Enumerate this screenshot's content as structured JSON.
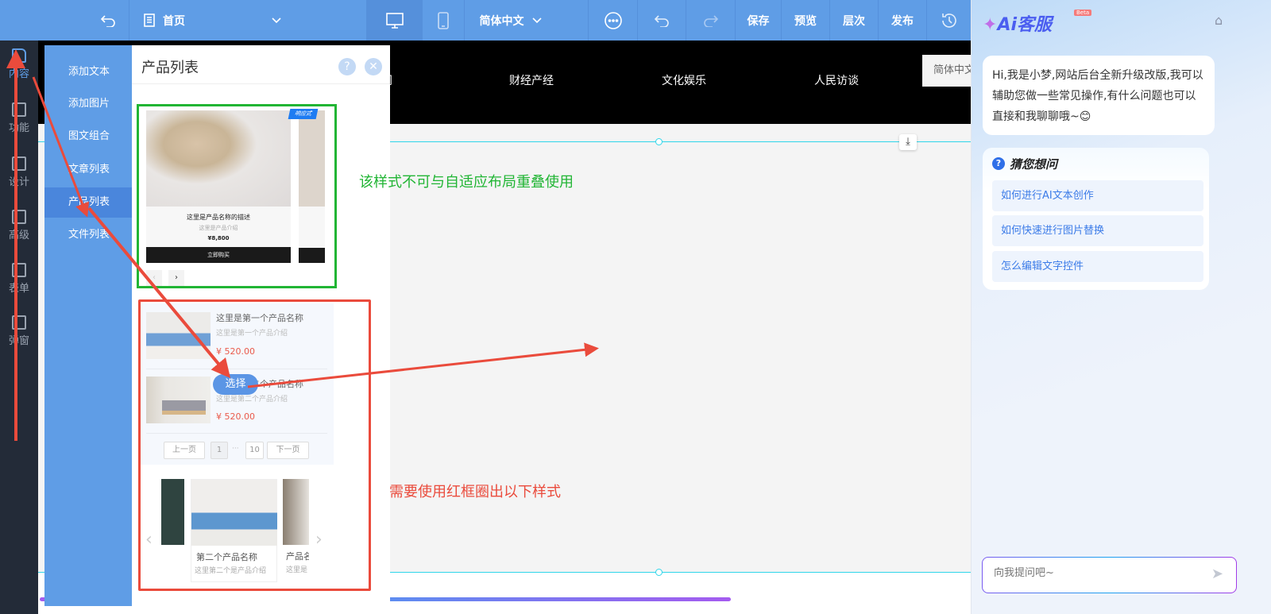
{
  "toolbar": {
    "page_select": "首页",
    "language": "简体中文",
    "save": "保存",
    "preview": "预览",
    "layers": "层次",
    "publish": "发布"
  },
  "sidebar": {
    "items": [
      {
        "label": "内容"
      },
      {
        "label": "功能"
      },
      {
        "label": "设计"
      },
      {
        "label": "高级"
      },
      {
        "label": "表单"
      },
      {
        "label": "弹窗"
      }
    ]
  },
  "submenu": {
    "items": [
      {
        "label": "添加文本"
      },
      {
        "label": "添加图片"
      },
      {
        "label": "图文组合"
      },
      {
        "label": "文章列表"
      },
      {
        "label": "产品列表"
      },
      {
        "label": "文件列表"
      }
    ],
    "active": "产品列表"
  },
  "panel": {
    "title": "产品列表",
    "style1": {
      "badge": "响应式",
      "name": "这里是产品名称的描述",
      "intro": "这里是产品介绍",
      "price": "¥8,800",
      "buy": "立即购买"
    },
    "style2": {
      "items": [
        {
          "name": "这里是第一个产品名称",
          "intro": "这里是第一个产品介绍",
          "price": "¥ 520.00"
        },
        {
          "name": "这里是第二个产品名称",
          "intro": "这里是第二个产品介绍",
          "price": "¥ 520.00"
        }
      ],
      "select_label": "选择",
      "prev": "上一页",
      "page1": "1",
      "ellipsis": "···",
      "page_last": "10",
      "next": "下一页"
    },
    "style3": {
      "center_name": "第二个产品名称",
      "center_intro": "这里第二个是产品介绍",
      "right_name": "产品名",
      "right_intro": "这里是"
    }
  },
  "canvas": {
    "nav": [
      "新闻",
      "财经产经",
      "文化娱乐",
      "人民访谈"
    ],
    "lang_box": "简体中文"
  },
  "annotations": {
    "green_note": "该样式不可与自适应布局重叠使用",
    "red_note": "需要使用红框圈出以下样式",
    "colors": {
      "green": "#21b534",
      "red": "#ea4b3c"
    }
  },
  "ai": {
    "title": "Ai客服",
    "beta": "Beta",
    "greeting": "Hi,我是小梦,网站后台全新升级改版,我可以辅助您做一些常见操作,有什么问题也可以直接和我聊聊哦~",
    "emoji": "😊",
    "guess_title": "猜您想问",
    "questions": [
      "如何进行AI文本创作",
      "如何快速进行图片替换",
      "怎么编辑文字控件"
    ],
    "input_placeholder": "向我提问吧~"
  }
}
